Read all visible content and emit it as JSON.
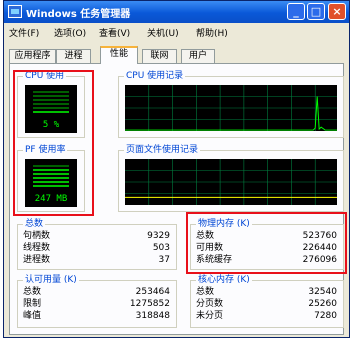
{
  "window": {
    "title": "Windows 任务管理器"
  },
  "title_buttons": {
    "minimize": "_",
    "maximize": "□",
    "close": "×"
  },
  "menu": [
    "文件(F)",
    "选项(O)",
    "查看(V)",
    "关机(U)",
    "帮助(H)"
  ],
  "tabs": [
    "应用程序",
    "进程",
    "性能",
    "联网",
    "用户"
  ],
  "active_tab": "性能",
  "cpu_usage": {
    "label": "CPU 使用",
    "value": "5 %"
  },
  "cpu_history": {
    "label": "CPU 使用记录"
  },
  "pf_usage": {
    "label": "PF 使用率",
    "value": "247 MB"
  },
  "pf_history": {
    "label": "页面文件使用记录"
  },
  "totals": {
    "label": "总数",
    "rows": [
      {
        "label": "句柄数",
        "value": "9329"
      },
      {
        "label": "线程数",
        "value": "503"
      },
      {
        "label": "进程数",
        "value": "37"
      }
    ]
  },
  "physical_memory": {
    "label": "物理内存 (K)",
    "rows": [
      {
        "label": "总数",
        "value": "523760"
      },
      {
        "label": "可用数",
        "value": "226440"
      },
      {
        "label": "系统缓存",
        "value": "276096"
      }
    ]
  },
  "commit_charge": {
    "label": "认可用量 (K)",
    "rows": [
      {
        "label": "总数",
        "value": "253464"
      },
      {
        "label": "限制",
        "value": "1275852"
      },
      {
        "label": "峰值",
        "value": "318848"
      }
    ]
  },
  "kernel_memory": {
    "label": "核心内存 (K)",
    "rows": [
      {
        "label": "总数",
        "value": "32540"
      },
      {
        "label": "分页数",
        "value": "25260"
      },
      {
        "label": "未分页",
        "value": "7280"
      }
    ]
  },
  "colors": {
    "highlight": "#e8101a",
    "graph_line": "#00ff00",
    "grid": "#008040",
    "group_label": "#0046d5"
  }
}
